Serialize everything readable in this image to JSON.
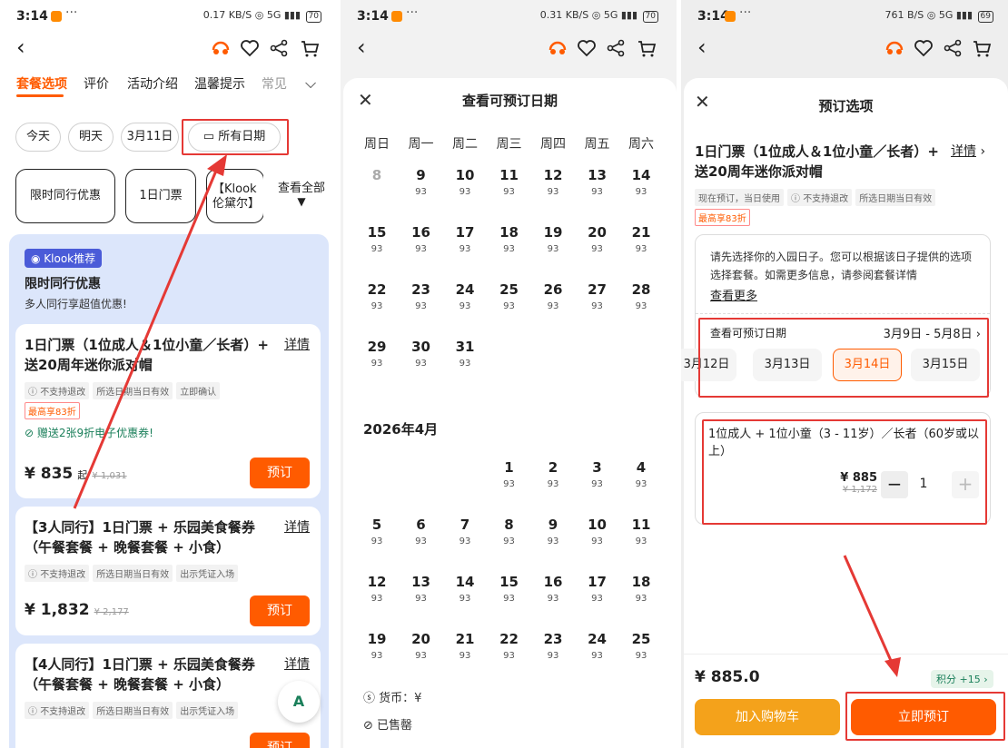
{
  "panel1": {
    "status": {
      "time": "3:14",
      "dots": "···",
      "net": "0.17 KB/S",
      "signal": "5G",
      "battery": "70"
    },
    "tabs": [
      "套餐选项",
      "评价",
      "活动介绍",
      "温馨提示",
      "常见"
    ],
    "date_chips": [
      "今天",
      "明天",
      "3月11日",
      "所有日期"
    ],
    "filter_chips": [
      "限时同行优惠",
      "1日门票",
      "【Klook伦黛尔】"
    ],
    "see_all": "查看全部",
    "promo": {
      "badge": "Klook推荐",
      "title": "限时同行优惠",
      "subtitle": "多人同行享超值优惠!"
    },
    "packages": [
      {
        "title": "1日门票（1位成人＆1位小童／长者）+ 送20周年迷你派对帽",
        "detail": "详情",
        "tags": [
          "不支持退改",
          "所选日期当日有效",
          "立即确认"
        ],
        "discount": "最高享83折",
        "coupon": "赠送2张9折电子优惠券!",
        "price": "¥ 835",
        "suffix": "起",
        "orig": "¥ 1,031",
        "btn": "预订"
      },
      {
        "title": "【3人同行】1日门票 + 乐园美食餐券 （午餐套餐 + 晚餐套餐 + 小食）",
        "detail": "详情",
        "tags": [
          "不支持退改",
          "所选日期当日有效",
          "出示凭证入场"
        ],
        "price": "¥ 1,832",
        "orig": "¥ 2,177",
        "btn": "预订"
      },
      {
        "title": "【4人同行】1日门票 + 乐园美食餐券 （午餐套餐 + 晚餐套餐 + 小食）",
        "detail": "详情",
        "tags": [
          "不支持退改",
          "所选日期当日有效",
          "出示凭证入场"
        ],
        "btn": "预订"
      }
    ]
  },
  "panel2": {
    "status": {
      "time": "3:14",
      "dots": "···",
      "net": "0.31 KB/S",
      "signal": "5G",
      "battery": "70"
    },
    "title": "查看可预订日期",
    "weekdays": [
      "周日",
      "周一",
      "周二",
      "周三",
      "周四",
      "周五",
      "周六"
    ],
    "march_rows": [
      [
        {
          "d": "8",
          "p": ""
        },
        {
          "d": "9",
          "p": "93"
        },
        {
          "d": "10",
          "p": "93"
        },
        {
          "d": "11",
          "p": "93"
        },
        {
          "d": "12",
          "p": "93"
        },
        {
          "d": "13",
          "p": "93"
        },
        {
          "d": "14",
          "p": "93"
        }
      ],
      [
        {
          "d": "15",
          "p": "93"
        },
        {
          "d": "16",
          "p": "93"
        },
        {
          "d": "17",
          "p": "93"
        },
        {
          "d": "18",
          "p": "93"
        },
        {
          "d": "19",
          "p": "93"
        },
        {
          "d": "20",
          "p": "93"
        },
        {
          "d": "21",
          "p": "93"
        }
      ],
      [
        {
          "d": "22",
          "p": "93"
        },
        {
          "d": "23",
          "p": "93"
        },
        {
          "d": "24",
          "p": "93"
        },
        {
          "d": "25",
          "p": "93"
        },
        {
          "d": "26",
          "p": "93"
        },
        {
          "d": "27",
          "p": "93"
        },
        {
          "d": "28",
          "p": "93"
        }
      ],
      [
        {
          "d": "29",
          "p": "93"
        },
        {
          "d": "30",
          "p": "93"
        },
        {
          "d": "31",
          "p": "93"
        }
      ]
    ],
    "april_label": "2026年4月",
    "april_rows": [
      [
        null,
        null,
        null,
        {
          "d": "1",
          "p": "93"
        },
        {
          "d": "2",
          "p": "93"
        },
        {
          "d": "3",
          "p": "93"
        },
        {
          "d": "4",
          "p": "93"
        }
      ],
      [
        {
          "d": "5",
          "p": "93"
        },
        {
          "d": "6",
          "p": "93"
        },
        {
          "d": "7",
          "p": "93"
        },
        {
          "d": "8",
          "p": "93"
        },
        {
          "d": "9",
          "p": "93"
        },
        {
          "d": "10",
          "p": "93"
        },
        {
          "d": "11",
          "p": "93"
        }
      ],
      [
        {
          "d": "12",
          "p": "93"
        },
        {
          "d": "13",
          "p": "93"
        },
        {
          "d": "14",
          "p": "93"
        },
        {
          "d": "15",
          "p": "93"
        },
        {
          "d": "16",
          "p": "93"
        },
        {
          "d": "17",
          "p": "93"
        },
        {
          "d": "18",
          "p": "93"
        }
      ],
      [
        {
          "d": "19",
          "p": "93"
        },
        {
          "d": "20",
          "p": "93"
        },
        {
          "d": "21",
          "p": "93"
        },
        {
          "d": "22",
          "p": "93"
        },
        {
          "d": "23",
          "p": "93"
        },
        {
          "d": "24",
          "p": "93"
        },
        {
          "d": "25",
          "p": "93"
        }
      ]
    ],
    "currency": "货币：¥",
    "sold_out": "已售罄"
  },
  "panel3": {
    "status": {
      "time": "3:14",
      "dots": "···",
      "net": "761 B/S",
      "signal": "5G",
      "battery": "69"
    },
    "title": "预订选项",
    "pkg_title": "1日门票（1位成人＆1位小童／长者）+ 送20周年迷你派对帽",
    "detail": "详情",
    "tags": [
      "现在预订，当日使用",
      "不支持退改",
      "所选日期当日有效"
    ],
    "discount": "最高享83折",
    "notice": "请先选择你的入园日子。您可以根据该日子提供的选项选择套餐。如需更多信息，请参阅套餐详情",
    "see_more": "查看更多",
    "date_label": "查看可预订日期",
    "date_range": "3月9日 - 5月8日",
    "dates": [
      "3月12日",
      "3月13日",
      "3月14日",
      "3月15日"
    ],
    "selected_date": "3月14日",
    "ticket_desc": "1位成人 + 1位小童（3 - 11岁）／长者（60岁或以上）",
    "ticket_price": "¥ 885",
    "ticket_orig": "¥ 1,172",
    "qty": "1",
    "total": "¥ 885.0",
    "points": "积分 +15",
    "cart_btn": "加入购物车",
    "book_btn": "立即预订"
  },
  "colors": {
    "accent": "#ff5b00",
    "cart": "#f4a21b",
    "annotation": "#e53935",
    "promo_bg": "#dce6fb",
    "link": "#1a7f5a"
  }
}
